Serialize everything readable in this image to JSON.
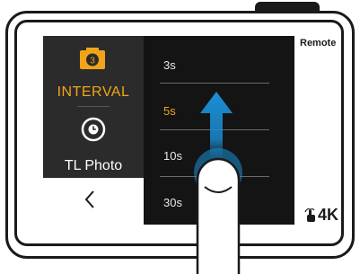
{
  "left_panel": {
    "mode_badge": "3",
    "mode_label": "INTERVAL",
    "submode_label": "TL Photo",
    "icons": [
      "camera-icon",
      "timer-icon",
      "chevron-left-icon"
    ]
  },
  "interval_options": [
    {
      "label": "3s",
      "selected": false
    },
    {
      "label": "5s",
      "selected": true
    },
    {
      "label": "10s",
      "selected": false
    },
    {
      "label": "30s",
      "selected": false
    }
  ],
  "status": {
    "remote_label": "Remote",
    "resolution_label": "4K",
    "hand_icon": "hand-icon"
  },
  "colors": {
    "accent": "#f0a419",
    "swipe_arrow": "#1a8fd6",
    "panel_dark": "#2b2b2b",
    "list_dark": "#141414"
  }
}
